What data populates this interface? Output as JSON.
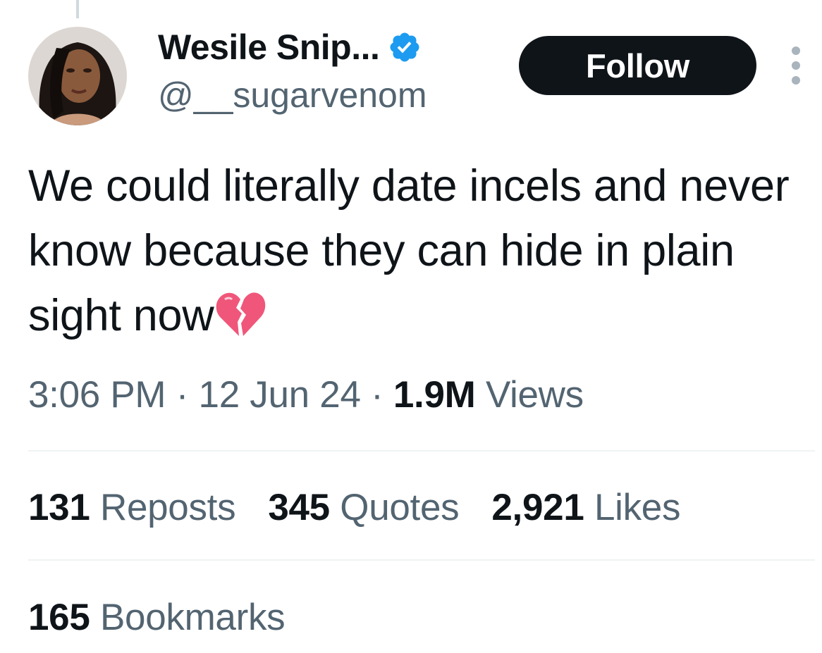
{
  "author": {
    "display_name": "Wesile Snip...",
    "handle": "@__sugarvenom",
    "verified": true
  },
  "header": {
    "follow_label": "Follow"
  },
  "tweet": {
    "text": "We could literally date incels and never know because they can hide in plain sight now",
    "emoji": "broken-heart"
  },
  "meta": {
    "time": "3:06 PM",
    "separator": "·",
    "date": "12 Jun 24",
    "views_count": "1.9M",
    "views_label": "Views"
  },
  "stats": {
    "reposts": {
      "count": "131",
      "label": "Reposts"
    },
    "quotes": {
      "count": "345",
      "label": "Quotes"
    },
    "likes": {
      "count": "2,921",
      "label": "Likes"
    },
    "bookmarks": {
      "count": "165",
      "label": "Bookmarks"
    }
  },
  "colors": {
    "text_primary": "#0f1419",
    "text_secondary": "#536471",
    "verified_blue": "#1d9bf0",
    "divider": "#eff3f4",
    "heart_pink": "#f0567a"
  }
}
